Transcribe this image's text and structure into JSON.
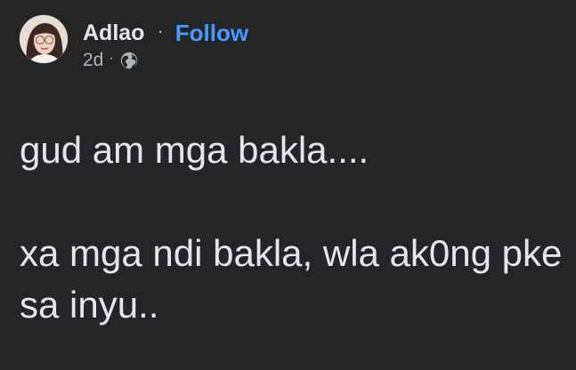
{
  "post": {
    "author": "Adlao",
    "separator": "·",
    "follow_label": "Follow",
    "time": "2d",
    "time_separator": "·",
    "privacy_icon": "globe-icon",
    "paragraphs": [
      "gud am mga bakla....",
      "xa mga ndi bakla, wla ak0ng pke sa inyu.."
    ]
  },
  "colors": {
    "background": "#242526",
    "text": "#e4e6eb",
    "secondary_text": "#b0b3b8",
    "link": "#4599ff"
  }
}
